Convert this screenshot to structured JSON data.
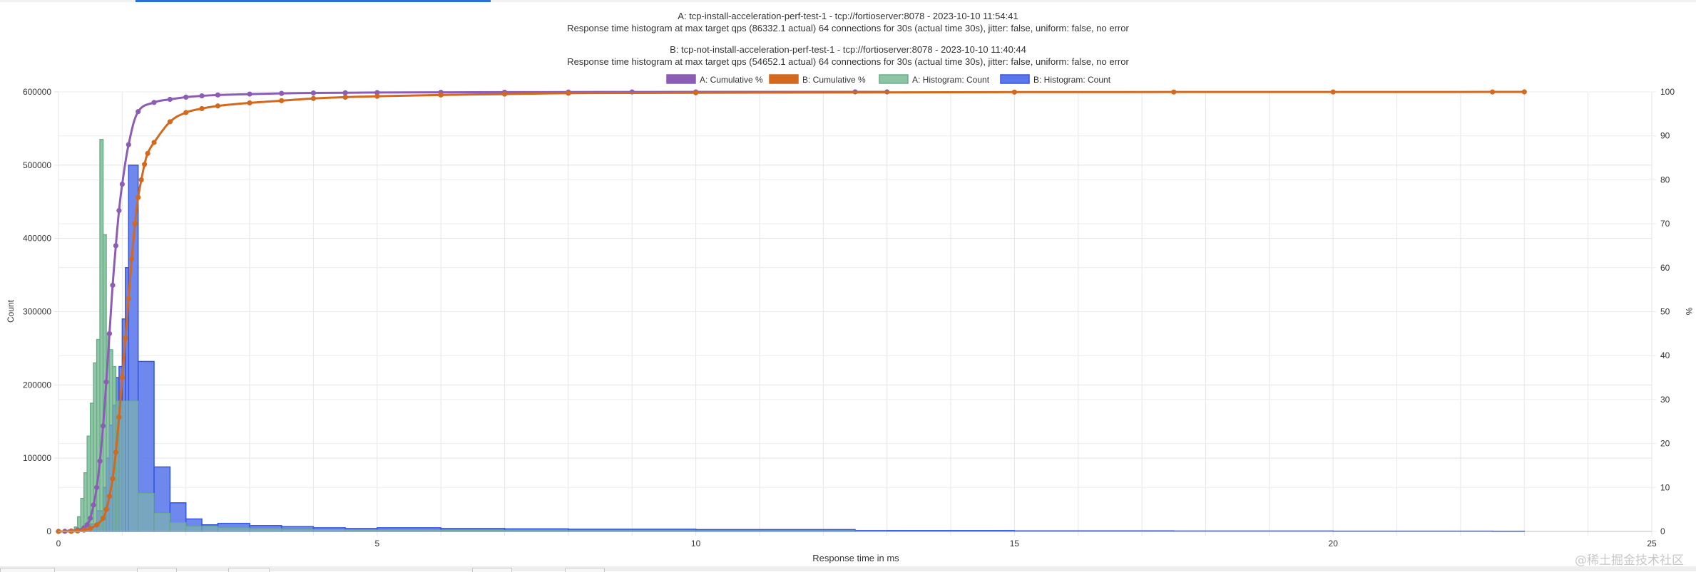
{
  "chart_data": {
    "type": "bar",
    "titles": [
      "A: tcp-install-acceleration-perf-test-1 - tcp://fortioserver:8078 - 2023-10-10 11:54:41",
      "Response time histogram at max target qps (86332.1 actual) 64 connections for 30s (actual time 30s), jitter: false, uniform: false, no error",
      "B: tcp-not-install-acceleration-perf-test-1 - tcp://fortioserver:8078 - 2023-10-10 11:40:44",
      "Response time histogram at max target qps (54652.1 actual) 64 connections for 30s (actual time 30s), jitter: false, uniform: false, no error"
    ],
    "xlabel": "Response time in ms",
    "ylabel": "Count",
    "y2label": "%",
    "xlim": [
      0,
      25
    ],
    "ylim": [
      0,
      600000
    ],
    "y2lim": [
      0,
      100
    ],
    "x_ticks": [
      "0",
      "5",
      "10",
      "15",
      "20",
      "25"
    ],
    "y_ticks": [
      "0",
      "100000",
      "200000",
      "300000",
      "400000",
      "500000",
      "600000"
    ],
    "y2_ticks": [
      "0",
      "10",
      "20",
      "30",
      "40",
      "50",
      "60",
      "70",
      "80",
      "90",
      "100"
    ],
    "grid": true,
    "legend_position": "top-center",
    "series": [
      {
        "name": "A: Cumulative %",
        "kind": "line",
        "axis": "right",
        "color": "#8c5db5",
        "x": [
          0,
          0.1,
          0.2,
          0.3,
          0.4,
          0.45,
          0.5,
          0.55,
          0.6,
          0.65,
          0.7,
          0.75,
          0.8,
          0.85,
          0.9,
          0.95,
          1.0,
          1.1,
          1.25,
          1.5,
          1.75,
          2.0,
          2.25,
          2.5,
          3.0,
          3.5,
          4.0,
          4.5,
          5.0,
          6.0,
          7.0,
          8.0,
          9.0,
          10.0,
          12.5,
          13.0
        ],
        "y": [
          0,
          0.02,
          0.1,
          0.3,
          0.8,
          1.5,
          3,
          6,
          10,
          16,
          24,
          34,
          45,
          56,
          65,
          73,
          79,
          88,
          95.5,
          97.6,
          98.3,
          98.8,
          99.1,
          99.3,
          99.5,
          99.65,
          99.75,
          99.8,
          99.85,
          99.9,
          99.93,
          99.96,
          99.98,
          99.99,
          100,
          100
        ]
      },
      {
        "name": "B: Cumulative %",
        "kind": "line",
        "axis": "right",
        "color": "#d2691e",
        "x": [
          0,
          0.2,
          0.3,
          0.4,
          0.5,
          0.6,
          0.7,
          0.75,
          0.8,
          0.85,
          0.9,
          0.95,
          1.0,
          1.05,
          1.1,
          1.15,
          1.2,
          1.25,
          1.3,
          1.35,
          1.4,
          1.5,
          1.75,
          2.0,
          2.25,
          2.5,
          3.0,
          3.5,
          4.0,
          4.5,
          5.0,
          6.0,
          7.0,
          8.0,
          10.0,
          15.0,
          17.5,
          20.0,
          22.5,
          23.0
        ],
        "y": [
          0,
          0.01,
          0.1,
          0.3,
          0.7,
          1.5,
          3,
          5,
          8,
          12,
          18,
          26,
          35,
          44,
          53,
          62,
          70,
          76,
          80,
          83.5,
          86,
          88.5,
          93.2,
          95.3,
          96.2,
          96.8,
          97.5,
          98,
          98.5,
          98.8,
          99,
          99.3,
          99.5,
          99.7,
          99.8,
          99.95,
          99.97,
          99.98,
          99.99,
          100
        ]
      },
      {
        "name": "A: Histogram: Count",
        "kind": "histogram",
        "axis": "left",
        "fill": "#8cc5a4",
        "stroke": "#6aad89",
        "bins": [
          [
            0.15,
            0.25,
            2000
          ],
          [
            0.25,
            0.3,
            6000
          ],
          [
            0.3,
            0.35,
            20000
          ],
          [
            0.35,
            0.4,
            45000
          ],
          [
            0.4,
            0.45,
            80000
          ],
          [
            0.45,
            0.5,
            130000
          ],
          [
            0.5,
            0.55,
            175000
          ],
          [
            0.55,
            0.6,
            230000
          ],
          [
            0.6,
            0.65,
            262000
          ],
          [
            0.65,
            0.7,
            535000
          ],
          [
            0.7,
            0.75,
            405000
          ],
          [
            0.75,
            0.8,
            270000
          ],
          [
            0.8,
            0.85,
            248000
          ],
          [
            0.85,
            0.9,
            225000
          ],
          [
            0.9,
            0.95,
            178000
          ],
          [
            0.95,
            1.0,
            178000
          ],
          [
            1.0,
            1.25,
            178000
          ],
          [
            1.25,
            1.5,
            52000
          ],
          [
            1.5,
            1.75,
            25000
          ],
          [
            1.75,
            2.0,
            12000
          ],
          [
            2.0,
            2.5,
            7000
          ],
          [
            2.5,
            3.0,
            5000
          ],
          [
            3.0,
            3.5,
            4000
          ],
          [
            3.5,
            4.0,
            3000
          ],
          [
            4.0,
            4.5,
            2500
          ],
          [
            4.5,
            5.0,
            2000
          ],
          [
            5.0,
            6.0,
            2000
          ],
          [
            6.0,
            7.0,
            1500
          ],
          [
            7.0,
            8.0,
            1200
          ],
          [
            8.0,
            10.0,
            1000
          ],
          [
            10.0,
            12.5,
            800
          ],
          [
            12.5,
            13.0,
            500
          ]
        ]
      },
      {
        "name": "B: Histogram: Count",
        "kind": "histogram",
        "axis": "left",
        "fill": "#5a78ec",
        "stroke": "#3655e0",
        "bins": [
          [
            0.3,
            0.4,
            1000
          ],
          [
            0.4,
            0.5,
            3000
          ],
          [
            0.5,
            0.6,
            10000
          ],
          [
            0.6,
            0.7,
            28000
          ],
          [
            0.7,
            0.75,
            60000
          ],
          [
            0.75,
            0.8,
            100000
          ],
          [
            0.8,
            0.85,
            145000
          ],
          [
            0.85,
            0.9,
            172000
          ],
          [
            0.9,
            0.95,
            210000
          ],
          [
            0.95,
            1.0,
            225000
          ],
          [
            1.0,
            1.05,
            290000
          ],
          [
            1.05,
            1.1,
            360000
          ],
          [
            1.1,
            1.25,
            500000
          ],
          [
            1.25,
            1.5,
            232000
          ],
          [
            1.5,
            1.75,
            88000
          ],
          [
            1.75,
            2.0,
            39000
          ],
          [
            2.0,
            2.25,
            17000
          ],
          [
            2.25,
            2.5,
            9000
          ],
          [
            2.5,
            3.0,
            11000
          ],
          [
            3.0,
            3.5,
            8000
          ],
          [
            3.5,
            4.0,
            6500
          ],
          [
            4.0,
            4.5,
            5000
          ],
          [
            4.5,
            5.0,
            4000
          ],
          [
            5.0,
            6.0,
            5000
          ],
          [
            6.0,
            7.0,
            4000
          ],
          [
            7.0,
            8.0,
            3500
          ],
          [
            8.0,
            10.0,
            3000
          ],
          [
            10.0,
            12.5,
            2500
          ],
          [
            12.5,
            15.0,
            1200
          ],
          [
            15.0,
            17.5,
            800
          ],
          [
            17.5,
            20.0,
            600
          ],
          [
            20.0,
            22.5,
            400
          ],
          [
            22.5,
            23.0,
            300
          ]
        ]
      }
    ]
  },
  "watermark": "@稀土掘金技术社区"
}
